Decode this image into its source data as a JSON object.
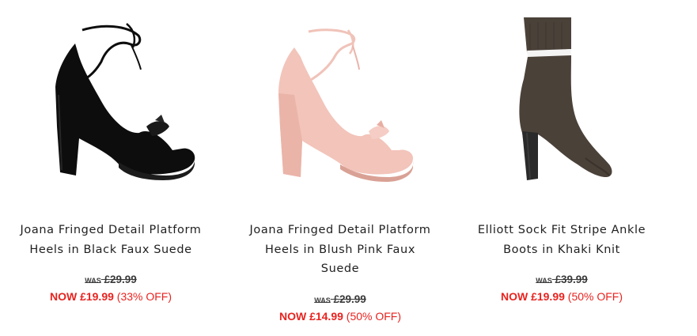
{
  "products": [
    {
      "name_line1": "Joana Fringed Detail Platform",
      "name_line2": "Heels in Black Faux Suede",
      "name_line3": "",
      "was_label": "WAS",
      "was_price": "£29.99",
      "now_label": "NOW",
      "now_price": "£19.99",
      "discount": "(33% OFF)",
      "image_icon": "black-platform-heel-image",
      "color": "#0d0d0d"
    },
    {
      "name_line1": "Joana Fringed Detail Platform",
      "name_line2": "Heels in Blush Pink Faux",
      "name_line3": "Suede",
      "was_label": "WAS",
      "was_price": "£29.99",
      "now_label": "NOW",
      "now_price": "£14.99",
      "discount": "(50% OFF)",
      "image_icon": "blush-pink-platform-heel-image",
      "color": "#efbdb4"
    },
    {
      "name_line1": "Elliott Sock Fit Stripe Ankle",
      "name_line2": "Boots in Khaki Knit",
      "name_line3": "",
      "was_label": "WAS",
      "was_price": "£39.99",
      "now_label": "NOW",
      "now_price": "£19.99",
      "discount": "(50% OFF)",
      "image_icon": "khaki-sock-boot-image",
      "color": "#4a4139"
    }
  ],
  "colors": {
    "price_red": "#e8231f",
    "was_gray": "#3a3a3a",
    "title_text": "#1f1f1f"
  }
}
